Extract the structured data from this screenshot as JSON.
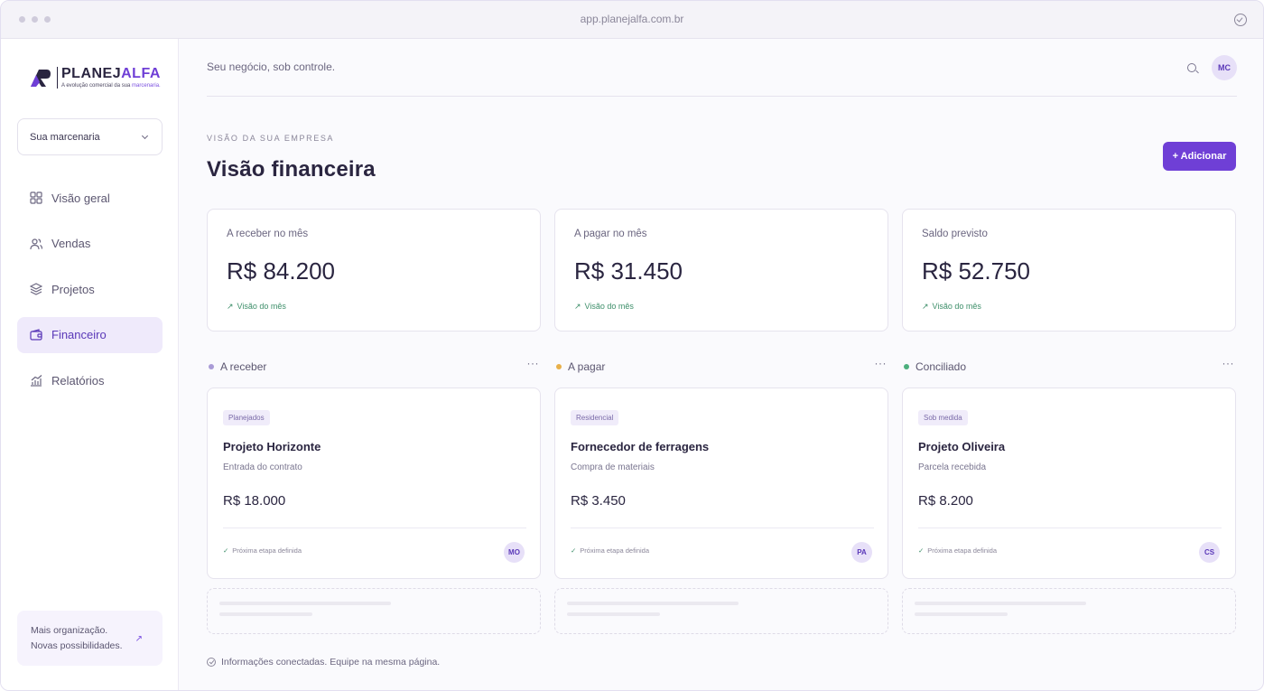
{
  "browser": {
    "url": "app.planejalfa.com.br"
  },
  "logo": {
    "name_a": "PLANEJ",
    "name_b": "ALFA",
    "tagline_a": "A evolução comercial da sua ",
    "tagline_b": "marcenaria."
  },
  "sidebar": {
    "select": {
      "value": "Sua marcenaria"
    },
    "items": [
      {
        "label": "Visão geral",
        "icon": "grid-icon"
      },
      {
        "label": "Vendas",
        "icon": "users-icon"
      },
      {
        "label": "Projetos",
        "icon": "layers-icon"
      },
      {
        "label": "Financeiro",
        "icon": "wallet-icon",
        "active": true
      },
      {
        "label": "Relatórios",
        "icon": "chart-icon"
      }
    ],
    "promo": {
      "line1": "Mais organização.",
      "line2": "Novas possibilidades.",
      "arrow": "↗"
    }
  },
  "header": {
    "tagline": "Seu negócio, sob controle.",
    "avatar": "MC"
  },
  "page": {
    "eyebrow": "VISÃO DA SUA EMPRESA",
    "title": "Visão financeira",
    "add_button": "+ Adicionar"
  },
  "stats": [
    {
      "label": "A receber no mês",
      "value": "R$ 84.200",
      "link": "Visão do mês"
    },
    {
      "label": "A pagar no mês",
      "value": "R$ 31.450",
      "link": "Visão do mês"
    },
    {
      "label": "Saldo previsto",
      "value": "R$ 52.750",
      "link": "Visão do mês"
    }
  ],
  "columns": [
    {
      "title": "A receber",
      "dot_color": "#a99bd6",
      "more": "···",
      "card": {
        "tag": "Planejados",
        "title": "Projeto Horizonte",
        "subtitle": "Entrada do contrato",
        "amount": "R$ 18.000",
        "status": "Próxima etapa definida",
        "avatar": "MO"
      }
    },
    {
      "title": "A pagar",
      "dot_color": "#e8b04a",
      "more": "···",
      "card": {
        "tag": "Residencial",
        "title": "Fornecedor de ferragens",
        "subtitle": "Compra de materiais",
        "amount": "R$ 3.450",
        "status": "Próxima etapa definida",
        "avatar": "PA"
      }
    },
    {
      "title": "Conciliado",
      "dot_color": "#4caf7d",
      "more": "···",
      "card": {
        "tag": "Sob medida",
        "title": "Projeto Oliveira",
        "subtitle": "Parcela recebida",
        "amount": "R$ 8.200",
        "status": "Próxima etapa definida",
        "avatar": "CS"
      }
    }
  ],
  "footer": {
    "text": "Informações conectadas. Equipe na mesma página."
  },
  "colors": {
    "accent": "#6f3fd6",
    "active_bg": "#efeafb",
    "positive": "#3e8f6a"
  }
}
